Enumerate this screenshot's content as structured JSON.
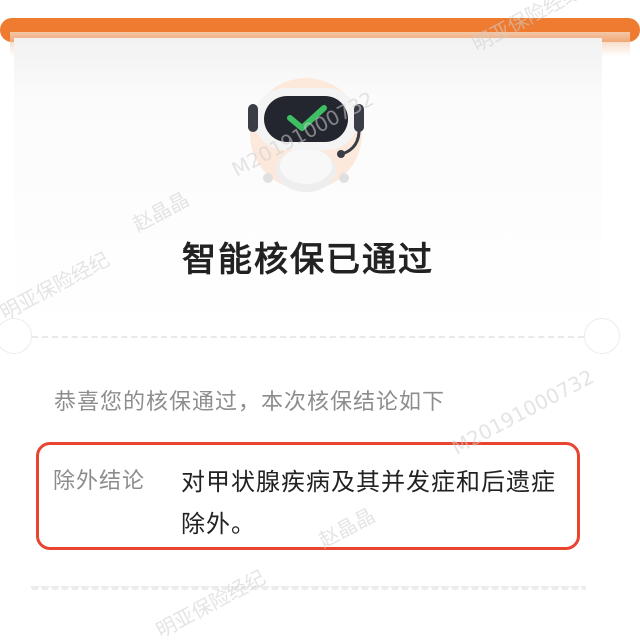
{
  "title": "智能核保已通过",
  "subtitle": "恭喜您的核保通过，本次核保结论如下",
  "result": {
    "label": "除外结论",
    "text": "对甲状腺疾病及其并发症和后遗症除外。"
  },
  "watermarks": {
    "company": "明亚保险经纪",
    "code": "M20191000732",
    "name": "赵晶晶"
  },
  "colors": {
    "accent": "#ee7b30",
    "highlight_border": "#e8452f",
    "check": "#3fbf64"
  },
  "icons": {
    "robot": "robot-check-icon"
  }
}
